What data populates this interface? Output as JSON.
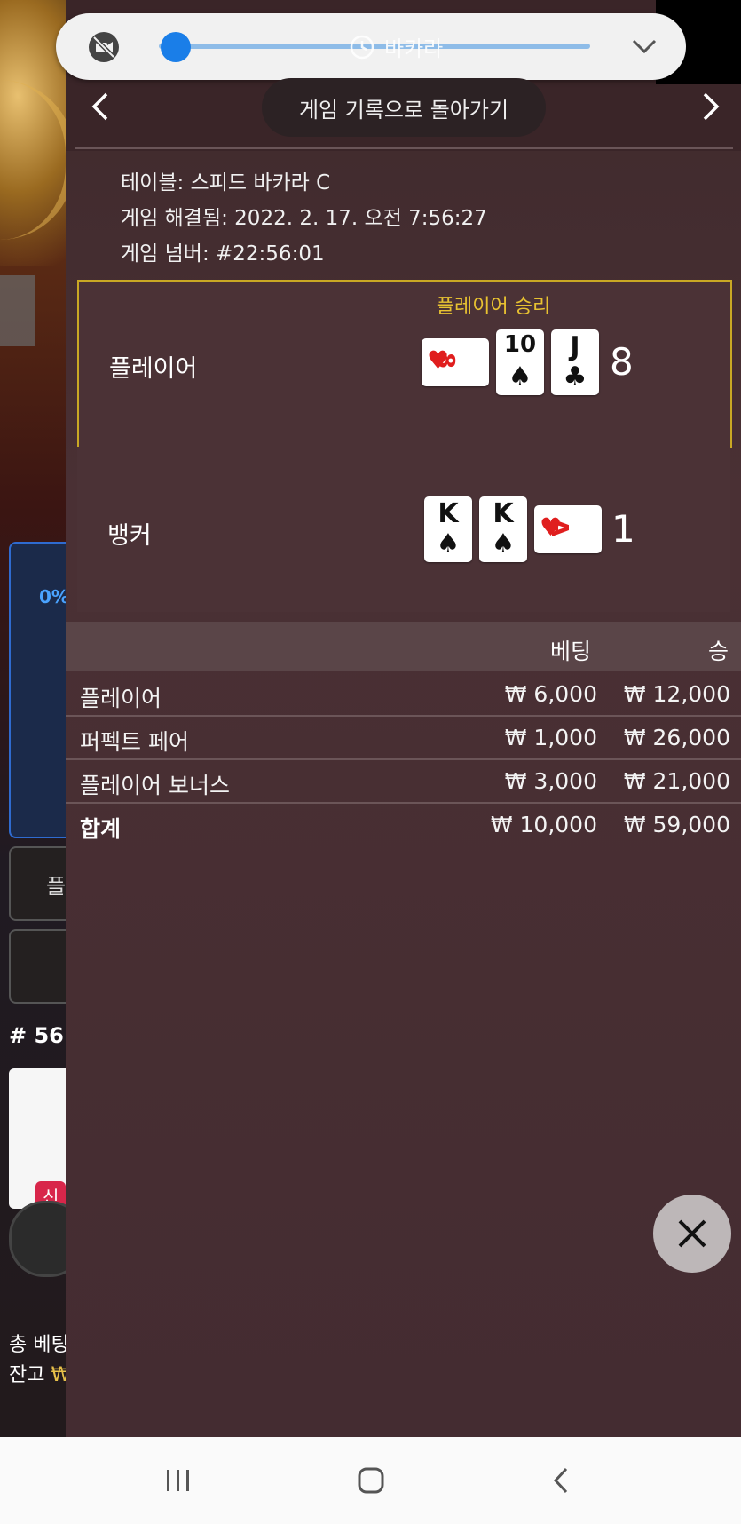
{
  "video_bar": {
    "title": "바카라",
    "volume": 0.04
  },
  "nav": {
    "back_label": "게임 기록으로 돌아가기"
  },
  "info": {
    "table": "테이블: 스피드 바카라 C",
    "resolved": "게임 해결됨: 2022. 2. 17. 오전 7:56:27",
    "number": "게임 넘버: #22:56:01"
  },
  "result": {
    "winner_label": "플레이어 승리",
    "player": {
      "name": "플레이어",
      "score": "8",
      "cards": [
        {
          "rank": "8",
          "suit": "♥",
          "color": "red",
          "rotated": true
        },
        {
          "rank": "10",
          "suit": "♠",
          "color": "black",
          "rotated": false
        },
        {
          "rank": "J",
          "suit": "♣",
          "color": "black",
          "rotated": false
        }
      ]
    },
    "banker": {
      "name": "뱅커",
      "score": "1",
      "cards": [
        {
          "rank": "K",
          "suit": "♠",
          "color": "black",
          "rotated": false
        },
        {
          "rank": "K",
          "suit": "♠",
          "color": "black",
          "rotated": false
        },
        {
          "rank": "A",
          "suit": "♥",
          "color": "red",
          "rotated": true
        }
      ]
    }
  },
  "bets": {
    "header_bet": "베팅",
    "header_win": "승",
    "rows": [
      {
        "label": "플레이어",
        "bet": "₩ 6,000",
        "win": "₩ 12,000"
      },
      {
        "label": "퍼펙트 페어",
        "bet": "₩ 1,000",
        "win": "₩ 26,000"
      },
      {
        "label": "플레이어 보너스",
        "bet": "₩ 3,000",
        "win": "₩ 21,000"
      }
    ],
    "total": {
      "label": "합계",
      "bet": "₩ 10,000",
      "win": "₩ 59,000"
    }
  },
  "background": {
    "percent": "0%",
    "button_label": "플",
    "round": "# 56",
    "new_badge": "신",
    "total_bet": "총 베팅",
    "balance_label": "잔고",
    "balance_value": "₩"
  },
  "colors": {
    "accent_yellow": "#e8c231",
    "slider_blue": "#1a7ee8",
    "card_red": "#e01e1e"
  }
}
